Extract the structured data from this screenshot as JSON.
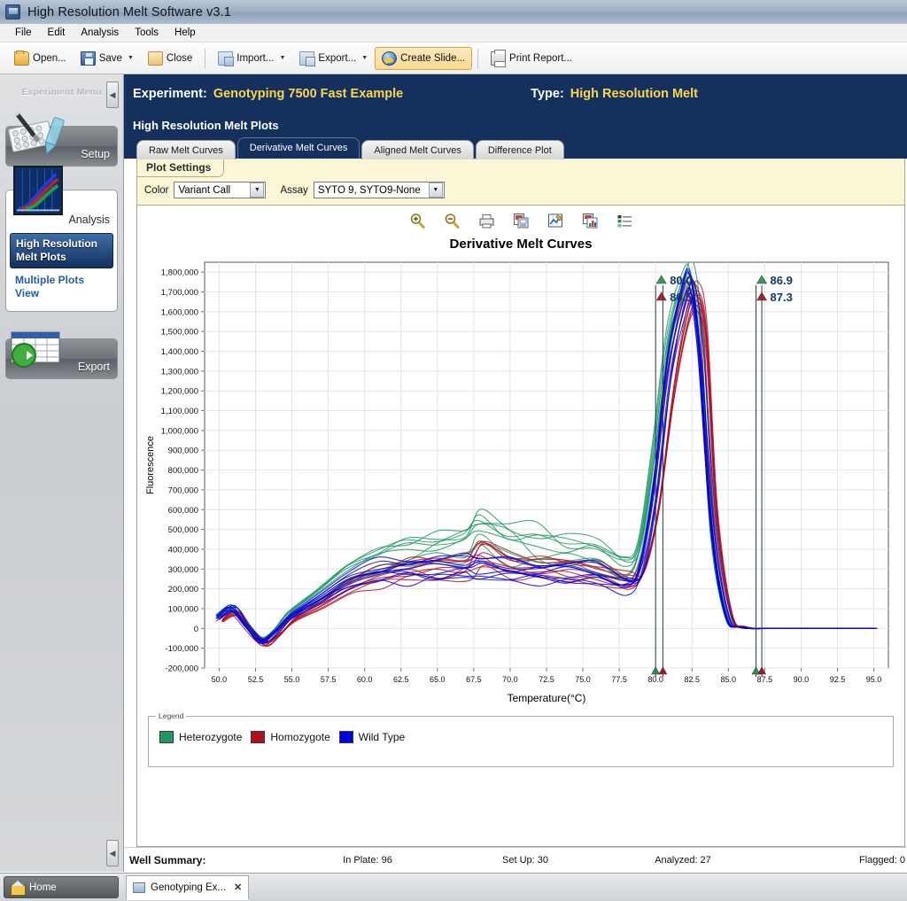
{
  "window": {
    "title": "High Resolution Melt Software v3.1",
    "icon": "app-icon"
  },
  "menubar": {
    "items": [
      "File",
      "Edit",
      "Analysis",
      "Tools",
      "Help"
    ]
  },
  "toolbar": {
    "open_label": "Open...",
    "save_label": "Save",
    "close_label": "Close",
    "import_label": "Import...",
    "export_label": "Export...",
    "create_slide_label": "Create Slide...",
    "print_report_label": "Print Report...",
    "caret": "▼"
  },
  "sidebar": {
    "header": "Experiment Menu",
    "collapse_icon": "◀",
    "expand_icon": "◀",
    "setup_label": "Setup",
    "analysis_label": "Analysis",
    "export_label": "Export",
    "analysis_items": [
      {
        "label": "High Resolution Melt Plots",
        "selected": true
      },
      {
        "label": "Multiple Plots View",
        "selected": false
      }
    ]
  },
  "experiment_header": {
    "experiment_label": "Experiment:",
    "experiment_name": "Genotyping 7500 Fast Example",
    "type_label": "Type:",
    "type_value": "High Resolution Melt"
  },
  "panel": {
    "title": "High Resolution Melt Plots",
    "tabs": [
      {
        "label": "Raw Melt Curves",
        "active": false
      },
      {
        "label": "Derivative Melt Curves",
        "active": true
      },
      {
        "label": "Aligned Melt Curves",
        "active": false
      },
      {
        "label": "Difference Plot",
        "active": false
      }
    ]
  },
  "plot_settings": {
    "tab_label": "Plot Settings",
    "color_label": "Color",
    "color_value": "Variant Call",
    "assay_label": "Assay",
    "assay_value": "SYTO 9, SYTO9-None",
    "combo_arrow": "▼"
  },
  "chart_toolbar": {
    "icons": [
      "zoom-in-icon",
      "zoom-out-icon",
      "print-icon",
      "save-image-icon",
      "chart-settings-icon",
      "copy-chart-icon",
      "legend-icon"
    ]
  },
  "chart_data": {
    "type": "line",
    "title": "Derivative Melt Curves",
    "xlabel": "Temperature(°C)",
    "ylabel": "Fluorescence",
    "xlim": [
      49.0,
      96.0
    ],
    "ylim": [
      -200000,
      1850000
    ],
    "grid": true,
    "xticks": [
      "50.0",
      "52.5",
      "55.0",
      "57.5",
      "60.0",
      "62.5",
      "65.0",
      "67.5",
      "70.0",
      "72.5",
      "75.0",
      "77.5",
      "80.0",
      "82.5",
      "85.0",
      "87.5",
      "90.0",
      "92.5",
      "95.0"
    ],
    "yticks": [
      "1,800,000",
      "1,700,000",
      "1,600,000",
      "1,500,000",
      "1,400,000",
      "1,300,000",
      "1,200,000",
      "1,100,000",
      "1,000,000",
      "900,000",
      "800,000",
      "700,000",
      "600,000",
      "500,000",
      "400,000",
      "300,000",
      "200,000",
      "100,000",
      "0",
      "-100,000",
      "-200,000"
    ],
    "markers": [
      {
        "value": "80.0",
        "color": "#1E8E4F",
        "shape": "triangle-up",
        "temperature": 80.0
      },
      {
        "value": "80.5",
        "color": "#A01020",
        "shape": "triangle-up",
        "temperature": 80.5
      },
      {
        "value": "86.9",
        "color": "#1E8E4F",
        "shape": "triangle-up",
        "temperature": 86.9
      },
      {
        "value": "87.3",
        "color": "#A01020",
        "shape": "triangle-up",
        "temperature": 87.3
      }
    ],
    "series": [
      {
        "name": "Heterozygote",
        "color": "#1E9960",
        "count": 9,
        "x": [
          50,
          51,
          52,
          53,
          54,
          55,
          57,
          59,
          61,
          63,
          65,
          67,
          68,
          70,
          72,
          74,
          76,
          78,
          79,
          80,
          81,
          82,
          82.6,
          83.2,
          84,
          85,
          86,
          88,
          90,
          92,
          95
        ],
        "values": [
          60000,
          95000,
          15000,
          -55000,
          -5000,
          75000,
          175000,
          280000,
          345000,
          380000,
          400000,
          420000,
          500000,
          415000,
          400000,
          395000,
          380000,
          300000,
          420000,
          900000,
          1480000,
          1740000,
          1770000,
          1420000,
          480000,
          60000,
          5000,
          0,
          0,
          0,
          0
        ]
      },
      {
        "name": "Homozygote",
        "color": "#B01020",
        "count": 9,
        "x": [
          50,
          51,
          52,
          53,
          54,
          55,
          57,
          59,
          61,
          63,
          65,
          67,
          68,
          70,
          72,
          74,
          76,
          78,
          79,
          80,
          81,
          82,
          82.7,
          83.3,
          84,
          85,
          86,
          88,
          90,
          92,
          95
        ],
        "values": [
          40000,
          80000,
          -5000,
          -80000,
          -30000,
          45000,
          130000,
          225000,
          275000,
          300000,
          310000,
          330000,
          390000,
          330000,
          310000,
          300000,
          290000,
          240000,
          300000,
          620000,
          1200000,
          1620000,
          1720000,
          1500000,
          600000,
          80000,
          8000,
          0,
          0,
          0,
          0
        ]
      },
      {
        "name": "Wild Type",
        "color": "#0000E0",
        "count": 9,
        "x": [
          50,
          51,
          52,
          53,
          54,
          55,
          57,
          59,
          61,
          63,
          65,
          67,
          68,
          70,
          72,
          74,
          76,
          78,
          79,
          80,
          81,
          82,
          82.5,
          83.1,
          84,
          85,
          86,
          88,
          90,
          92,
          95
        ],
        "values": [
          55000,
          100000,
          10000,
          -65000,
          -15000,
          60000,
          150000,
          240000,
          285000,
          300000,
          300000,
          305000,
          300000,
          290000,
          285000,
          280000,
          270000,
          230000,
          290000,
          700000,
          1350000,
          1700000,
          1760000,
          1450000,
          520000,
          65000,
          5000,
          0,
          0,
          0,
          0
        ]
      }
    ]
  },
  "legend": {
    "caption": "Legend",
    "items": [
      {
        "label": "Heterozygote",
        "color": "#1E9960"
      },
      {
        "label": "Homozygote",
        "color": "#B01020"
      },
      {
        "label": "Wild Type",
        "color": "#0000E0"
      }
    ]
  },
  "well_summary": {
    "title": "Well Summary:",
    "in_plate": "In Plate: 96",
    "set_up": "Set Up: 30",
    "analyzed": "Analyzed: 27",
    "flagged": "Flagged: 0"
  },
  "taskbar": {
    "home_label": "Home",
    "tab_label": "Genotyping Ex...",
    "tab_close": "✕"
  }
}
